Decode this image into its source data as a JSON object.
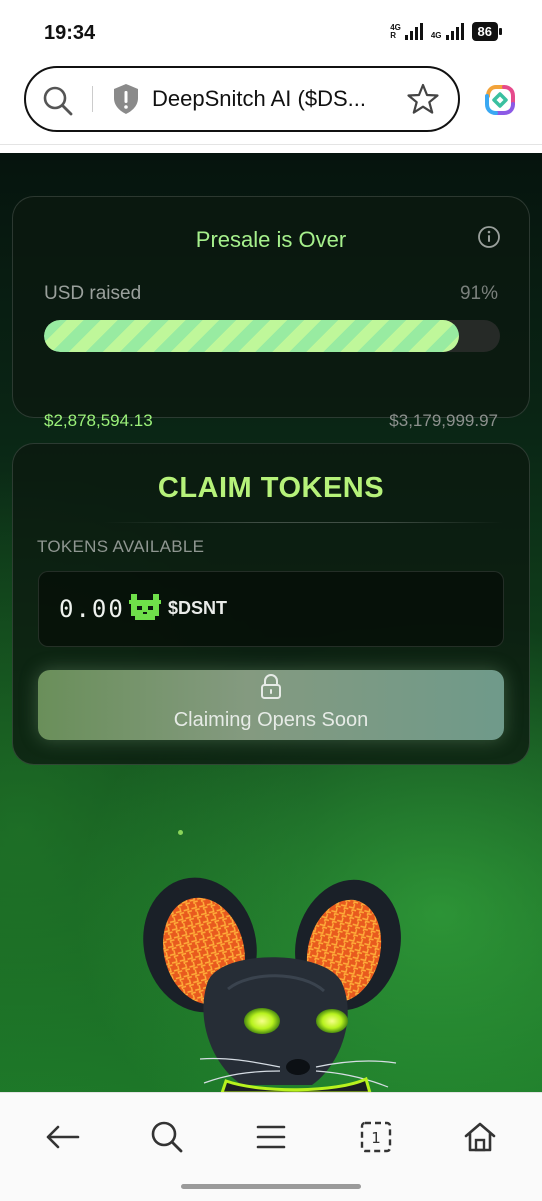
{
  "status_bar": {
    "time": "19:34",
    "network1": "4G",
    "network1_sub": "R",
    "network2": "4G",
    "battery": "86"
  },
  "browser": {
    "url_text": "DeepSnitch AI ($DS...",
    "search_icon": "search-icon",
    "site_icon": "shield-warning-icon",
    "bookmark_icon": "star-icon",
    "extension_icon": "extension-logo-icon"
  },
  "presale": {
    "title": "Presale is Over",
    "raised_label": "USD raised",
    "percent_text": "91%",
    "progress": 0.91,
    "raised_amount": "$2,878,594.13",
    "goal_amount": "$3,179,999.97"
  },
  "claim": {
    "title": "CLAIM TOKENS",
    "available_label": "TOKENS AVAILABLE",
    "amount": "0.00",
    "symbol": "$DSNT",
    "button_label": "Claiming Opens Soon"
  },
  "colors": {
    "accent_green": "#a6f08c",
    "claim_title": "#b6f27a",
    "page_bg": "#0a2615"
  },
  "bottom_nav": {
    "icons": [
      "arrow-left-icon",
      "search-icon",
      "menu-icon",
      "tabs-icon",
      "home-icon"
    ],
    "tab_count": "1"
  }
}
